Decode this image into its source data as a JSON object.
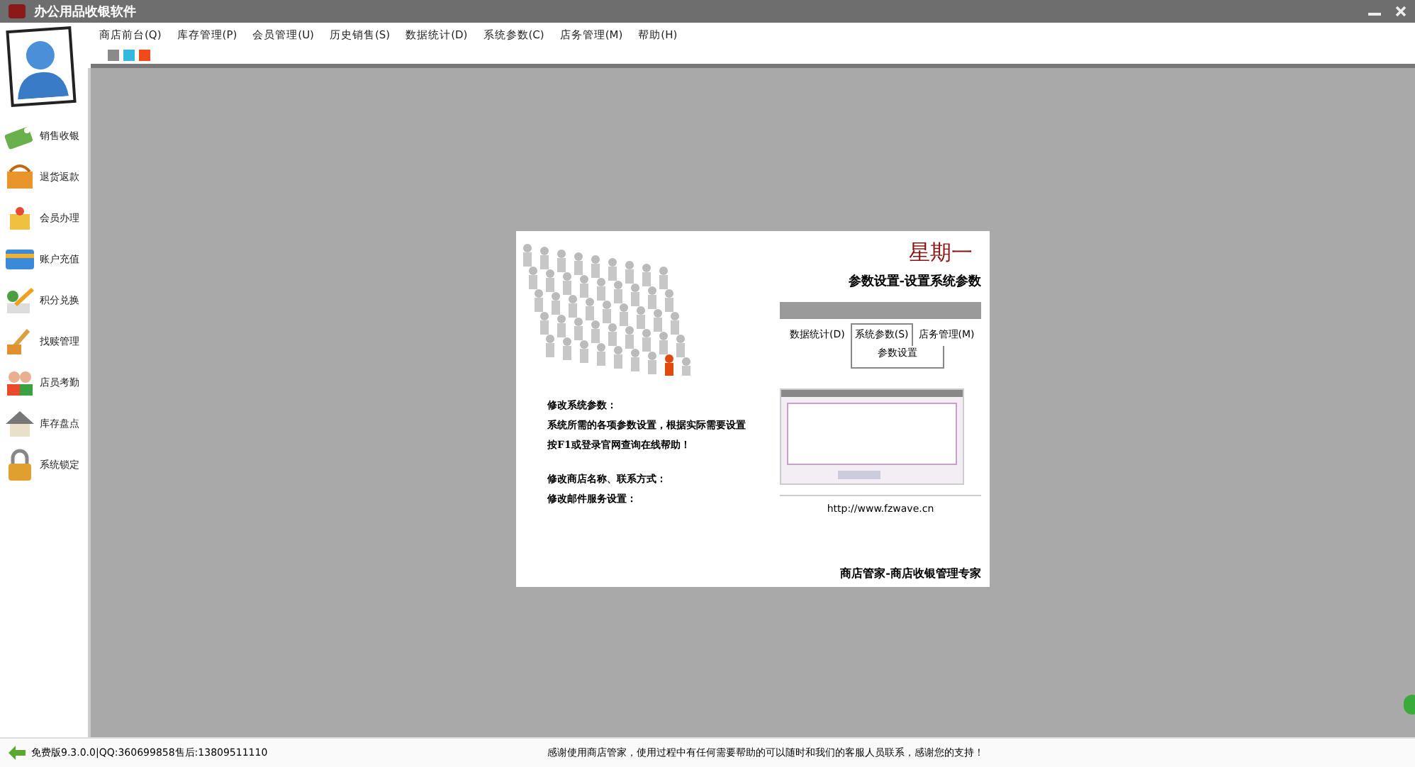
{
  "window": {
    "title": "办公用品收银软件"
  },
  "menu": [
    "商店前台(Q)",
    "库存管理(P)",
    "会员管理(U)",
    "历史销售(S)",
    "数据统计(D)",
    "系统参数(C)",
    "店务管理(M)",
    "帮助(H)"
  ],
  "swatches": [
    {
      "color": "#8a8a8a"
    },
    {
      "color": "#34b8e0"
    },
    {
      "color": "#f04a1a"
    }
  ],
  "sidebar": {
    "items": [
      {
        "label": "销售收银",
        "kind": "tag"
      },
      {
        "label": "退货返款",
        "kind": "basket"
      },
      {
        "label": "会员办理",
        "kind": "gift"
      },
      {
        "label": "账户充值",
        "kind": "card"
      },
      {
        "label": "积分兑换",
        "kind": "pencil"
      },
      {
        "label": "找赎管理",
        "kind": "tools"
      },
      {
        "label": "店员考勤",
        "kind": "people"
      },
      {
        "label": "库存盘点",
        "kind": "house"
      },
      {
        "label": "系统锁定",
        "kind": "lock"
      }
    ]
  },
  "splash": {
    "weekday": "星期一",
    "heading": "参数设置-设置系统参数",
    "tabs": [
      {
        "label": "数据统计(D)",
        "selected": false
      },
      {
        "label": "系统参数(S)",
        "selected": true
      },
      {
        "label": "店务管理(M)",
        "selected": false
      }
    ],
    "tab_content": "参数设置",
    "paragraphs": [
      [
        "修改系统参数：",
        "系统所需的各项参数设置，根据实际需要设置",
        "按F1或登录官网查询在线帮助！"
      ],
      [
        "修改商店名称、联系方式：",
        "修改邮件服务设置："
      ]
    ],
    "url": "http://www.fzwave.cn",
    "footer": "商店管家-商店收银管理专家"
  },
  "status_bar": {
    "version": "免费版9.3.0.0|QQ:360699858售后:13809511110",
    "message": "感谢使用商店管家，使用过程中有任何需要帮助的可以随时和我们的客服人员联系，感谢您的支持！"
  }
}
